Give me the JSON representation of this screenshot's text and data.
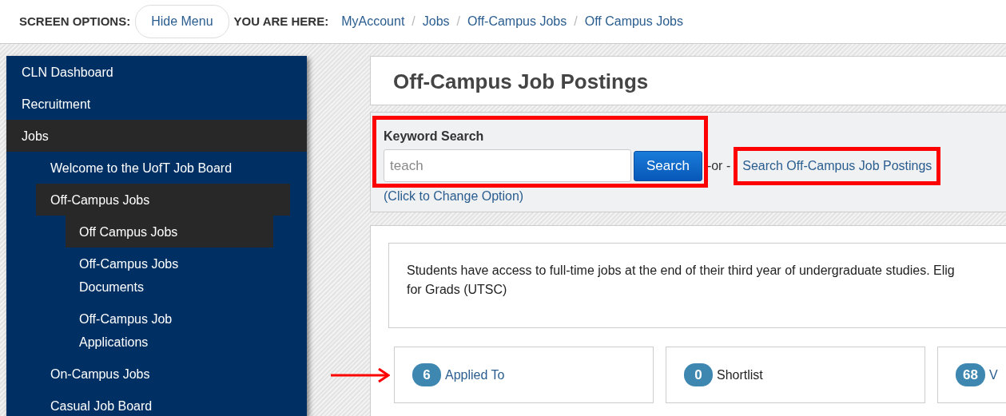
{
  "screen_options": {
    "label": "SCREEN OPTIONS:",
    "button": "Hide Menu"
  },
  "breadcrumb": {
    "label": "YOU ARE HERE:",
    "items": [
      "MyAccount",
      "Jobs",
      "Off-Campus Jobs",
      "Off Campus Jobs"
    ],
    "separators": [
      "/",
      "/",
      "/"
    ]
  },
  "sidebar": {
    "items": [
      {
        "label": "CLN Dashboard",
        "selected": false
      },
      {
        "label": "Recruitment",
        "selected": false
      },
      {
        "label": "Jobs",
        "selected": true,
        "children": [
          {
            "label": "Welcome to the UofT Job Board",
            "selected": false
          },
          {
            "label": "Off-Campus Jobs",
            "selected": true,
            "children": [
              {
                "label": "Off Campus Jobs",
                "selected": true
              },
              {
                "label": "Off-Campus Jobs Documents",
                "selected": false
              },
              {
                "label": "Off-Campus Job Applications",
                "selected": false
              }
            ]
          },
          {
            "label": "On-Campus Jobs",
            "selected": false
          },
          {
            "label": "Casual Job Board",
            "selected": false
          }
        ]
      }
    ]
  },
  "page_title": "Off-Campus Job Postings",
  "search": {
    "label": "Keyword Search",
    "value": "teach",
    "button": "Search",
    "separator": "-or -",
    "highlighted": true
  },
  "alternative": {
    "link": "Search Off-Campus Job Postings",
    "highlighted": true
  },
  "change_option": "(Click to Change Option)",
  "notice": {
    "lines": [
      "Students have access to full-time jobs at the end of their third year of undergraduate studies. Elig",
      "for Grads (UTSC)"
    ]
  },
  "stats": [
    {
      "count": "6",
      "label": "Applied To",
      "kind": "link"
    },
    {
      "count": "0",
      "label": "Shortlist",
      "kind": "plain"
    },
    {
      "count": "68",
      "label": "V",
      "kind": "link"
    }
  ],
  "annotations": [
    {
      "kind": "arrow"
    }
  ]
}
